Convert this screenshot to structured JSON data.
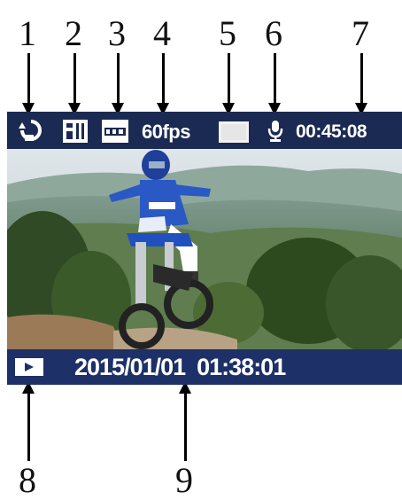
{
  "callouts": [
    "1",
    "2",
    "3",
    "4",
    "5",
    "6",
    "7",
    "8",
    "9"
  ],
  "icons": {
    "loop": "loop-recording-icon",
    "quality": "image-quality-icon",
    "size": "video-size-icon",
    "hdr": "hdr-icon",
    "mic": "microphone-icon",
    "mode": "video-mode-icon"
  },
  "status_bar": {
    "fps": "60fps",
    "record_time": "00:45:08"
  },
  "bottom_bar": {
    "datetime": "2015/01/01  01:38:01"
  },
  "colors": {
    "bar": "#1b2a52",
    "bar_bottom": "#1d3068",
    "text": "#ffffff"
  }
}
